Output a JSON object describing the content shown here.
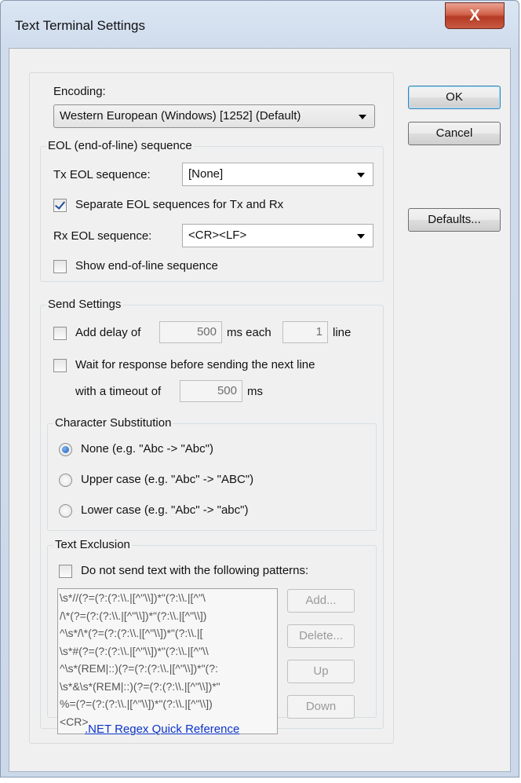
{
  "window": {
    "title": "Text Terminal Settings",
    "close_glyph": "X"
  },
  "encoding": {
    "label": "Encoding:",
    "value": "Western European (Windows) [1252] (Default)"
  },
  "eol": {
    "group_label": "EOL (end-of-line) sequence",
    "tx_label": "Tx EOL sequence:",
    "tx_value": "[None]",
    "separate_label": "Separate EOL sequences for Tx and Rx",
    "separate_checked": true,
    "rx_label": "Rx EOL sequence:",
    "rx_value": "<CR><LF>",
    "show_label": "Show end-of-line sequence",
    "show_checked": false
  },
  "send": {
    "group_label": "Send Settings",
    "add_delay_label": "Add delay of",
    "delay_value": "500",
    "ms_each_label": "ms each",
    "lines_value": "1",
    "line_label": "line",
    "wait_label": "Wait for response before sending the next line",
    "timeout_label": "with a timeout of",
    "timeout_value": "500",
    "ms_label": "ms"
  },
  "substitution": {
    "group_label": "Character Substitution",
    "options": [
      {
        "label": "None (e.g. \"Abc -> \"Abc\")",
        "selected": true
      },
      {
        "label": "Upper case (e.g. \"Abc\" -> \"ABC\")",
        "selected": false
      },
      {
        "label": "Lower case (e.g. \"Abc\" -> \"abc\")",
        "selected": false
      }
    ]
  },
  "exclusion": {
    "group_label": "Text Exclusion",
    "checkbox_label": "Do not send text with the following patterns:",
    "patterns": [
      "\\s*//(?=(?:(?:\\\\.|[^\"\\\\])*\"(?:\\\\.|[^\"\\",
      "/\\*(?=(?:(?:\\\\.|[^\"\\\\])*\"(?:\\\\.|[^\"\\\\])",
      "^\\s*/\\*(?=(?:(?:\\\\.|[^\"\\\\])*\"(?:\\\\.|[",
      "\\s*#(?=(?:(?:\\\\.|[^\"\\\\])*\"(?:\\\\.|[^\"\\\\",
      "^\\s*(REM|::)(?=(?:(?:\\\\.|[^\"\\\\])*\"(?:",
      "\\s*&\\s*(REM|::)(?=(?:(?:\\\\.|[^\"\\\\])*\"",
      "%=(?=(?:(?:\\\\.|[^\"\\\\])*\"(?:\\\\.|[^\"\\\\])",
      "<CR>"
    ],
    "add_label": "Add...",
    "delete_label": "Delete...",
    "up_label": "Up",
    "down_label": "Down",
    "link_label": ".NET Regex Quick Reference"
  },
  "buttons": {
    "ok": "OK",
    "cancel": "Cancel",
    "defaults": "Defaults..."
  }
}
